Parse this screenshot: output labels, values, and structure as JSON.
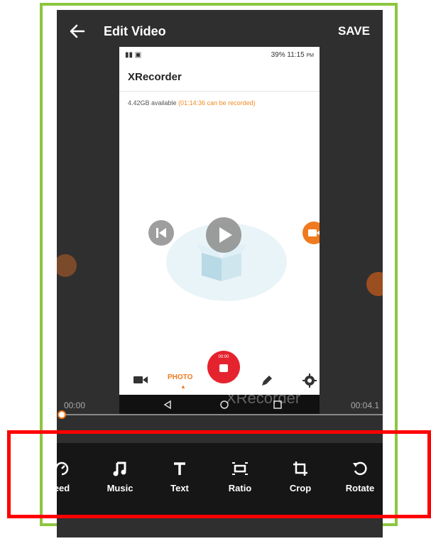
{
  "header": {
    "title": "Edit Video",
    "save_label": "SAVE"
  },
  "preview": {
    "status_time": "11:15",
    "status_ampm": "PM",
    "battery": "39%",
    "app_title": "XRecorder",
    "available": "4.42GB available",
    "recordable": "(01:14:36 can be recorded)",
    "mode_label": "PHOTO",
    "stop_time": "00:00",
    "watermark": "XRecorder"
  },
  "timeline": {
    "start": "00:00",
    "end": "00:04.1",
    "progress": 0.0
  },
  "tools": [
    {
      "label": "eed",
      "icon": "speed-icon"
    },
    {
      "label": "Music",
      "icon": "music-note-icon"
    },
    {
      "label": "Text",
      "icon": "text-icon"
    },
    {
      "label": "Ratio",
      "icon": "ratio-icon"
    },
    {
      "label": "Crop",
      "icon": "crop-icon"
    },
    {
      "label": "Rotate",
      "icon": "rotate-icon"
    }
  ],
  "colors": {
    "accent": "#f07a1f",
    "record": "#e5232e",
    "frame": "#8cc63f",
    "highlight": "#ff0000"
  }
}
